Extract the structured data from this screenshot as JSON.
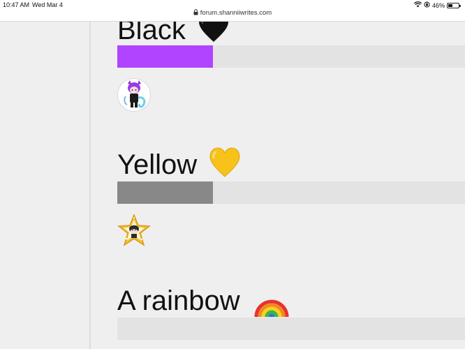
{
  "status_bar": {
    "time": "10:47 AM",
    "date": "Wed Mar 4",
    "url": "forum.shanniiwrites.com",
    "battery_percent": "46%",
    "battery_level": 0.46,
    "icons": [
      "wifi-icon",
      "lock-rotation-icon",
      "battery-icon"
    ]
  },
  "poll": {
    "options": [
      {
        "label": "Black",
        "emoji": "🖤",
        "fraction": 0.275,
        "bar_color": "#b144ff"
      },
      {
        "label": "Yellow",
        "emoji": "💛",
        "fraction": 0.275,
        "bar_color": "#888888"
      },
      {
        "label": "A rainbow",
        "emoji": "🌈",
        "fraction": 0,
        "bar_color": "#888888"
      }
    ],
    "voters": [
      {
        "name": "purple-anime-avatar"
      },
      {
        "name": "star-frame-avatar"
      }
    ]
  },
  "colors": {
    "page_bg": "#efefef",
    "track": "#e3e3e3",
    "accent_purple": "#b144ff",
    "neutral_bar": "#888888"
  }
}
